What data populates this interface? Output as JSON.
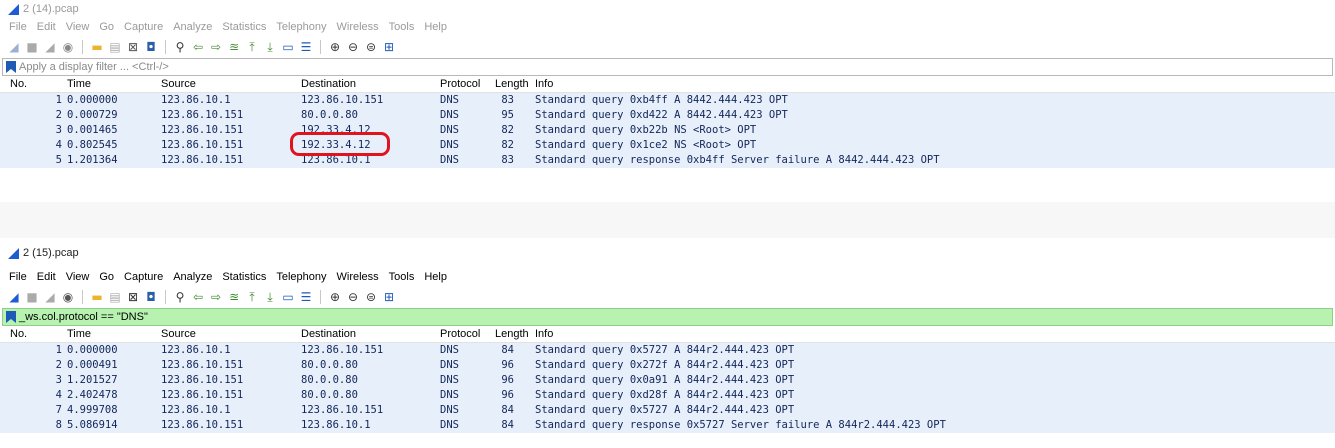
{
  "windows": [
    {
      "title": "2 (14).pcap",
      "menu": [
        "File",
        "Edit",
        "View",
        "Go",
        "Capture",
        "Analyze",
        "Statistics",
        "Telephony",
        "Wireless",
        "Tools",
        "Help"
      ],
      "filter": {
        "value": "",
        "placeholder": "Apply a display filter ... <Ctrl-/>"
      },
      "columns": [
        "No.",
        "Time",
        "Source",
        "Destination",
        "Protocol",
        "Length",
        "Info"
      ],
      "packets": [
        {
          "no": "1",
          "time": "0.000000",
          "src": "123.86.10.1",
          "dst": "123.86.10.151",
          "proto": "DNS",
          "len": "83",
          "info": "Standard query 0xb4ff A 8442.444.423 OPT"
        },
        {
          "no": "2",
          "time": "0.000729",
          "src": "123.86.10.151",
          "dst": "80.0.0.80",
          "proto": "DNS",
          "len": "95",
          "info": "Standard query 0xd422 A 8442.444.423 OPT"
        },
        {
          "no": "3",
          "time": "0.001465",
          "src": "123.86.10.151",
          "dst": "192.33.4.12",
          "proto": "DNS",
          "len": "82",
          "info": "Standard query 0xb22b NS <Root> OPT"
        },
        {
          "no": "4",
          "time": "0.802545",
          "src": "123.86.10.151",
          "dst": "192.33.4.12",
          "proto": "DNS",
          "len": "82",
          "info": "Standard query 0x1ce2 NS <Root> OPT"
        },
        {
          "no": "5",
          "time": "1.201364",
          "src": "123.86.10.151",
          "dst": "123.86.10.1",
          "proto": "DNS",
          "len": "83",
          "info": "Standard query response 0xb4ff Server failure A 8442.444.423 OPT"
        }
      ]
    },
    {
      "title": "2 (15).pcap",
      "menu": [
        "File",
        "Edit",
        "View",
        "Go",
        "Capture",
        "Analyze",
        "Statistics",
        "Telephony",
        "Wireless",
        "Tools",
        "Help"
      ],
      "filter": {
        "value": "_ws.col.protocol == \"DNS\"",
        "placeholder": ""
      },
      "columns": [
        "No.",
        "Time",
        "Source",
        "Destination",
        "Protocol",
        "Length",
        "Info"
      ],
      "packets": [
        {
          "no": "1",
          "time": "0.000000",
          "src": "123.86.10.1",
          "dst": "123.86.10.151",
          "proto": "DNS",
          "len": "84",
          "info": "Standard query 0x5727 A 844r2.444.423 OPT"
        },
        {
          "no": "2",
          "time": "0.000491",
          "src": "123.86.10.151",
          "dst": "80.0.0.80",
          "proto": "DNS",
          "len": "96",
          "info": "Standard query 0x272f A 844r2.444.423 OPT"
        },
        {
          "no": "3",
          "time": "1.201527",
          "src": "123.86.10.151",
          "dst": "80.0.0.80",
          "proto": "DNS",
          "len": "96",
          "info": "Standard query 0x0a91 A 844r2.444.423 OPT"
        },
        {
          "no": "4",
          "time": "2.402478",
          "src": "123.86.10.151",
          "dst": "80.0.0.80",
          "proto": "DNS",
          "len": "96",
          "info": "Standard query 0xd28f A 844r2.444.423 OPT"
        },
        {
          "no": "7",
          "time": "4.999708",
          "src": "123.86.10.1",
          "dst": "123.86.10.151",
          "proto": "DNS",
          "len": "84",
          "info": "Standard query 0x5727 A 844r2.444.423 OPT"
        },
        {
          "no": "8",
          "time": "5.086914",
          "src": "123.86.10.151",
          "dst": "123.86.10.1",
          "proto": "DNS",
          "len": "84",
          "info": "Standard query response 0x5727 Server failure A 844r2.444.423 OPT"
        }
      ]
    }
  ],
  "toolbar_icons": [
    "shark-fin-start-icon",
    "stop-capture-icon",
    "restart-capture-icon",
    "capture-options-icon",
    "open-file-icon",
    "save-file-icon",
    "close-file-icon",
    "reload-file-icon",
    "find-packet-icon",
    "go-back-icon",
    "go-forward-icon",
    "go-to-packet-icon",
    "go-first-icon",
    "go-last-icon",
    "autoscroll-icon",
    "colorize-icon",
    "zoom-in-icon",
    "zoom-out-icon",
    "zoom-normal-icon",
    "resize-columns-icon"
  ],
  "colors": {
    "row_bg": "#e7f0fa",
    "row_text": "#12255a",
    "filter_applied": "#b7f2b1",
    "annotation": "#e0141e",
    "accent": "#1e5cd6"
  }
}
